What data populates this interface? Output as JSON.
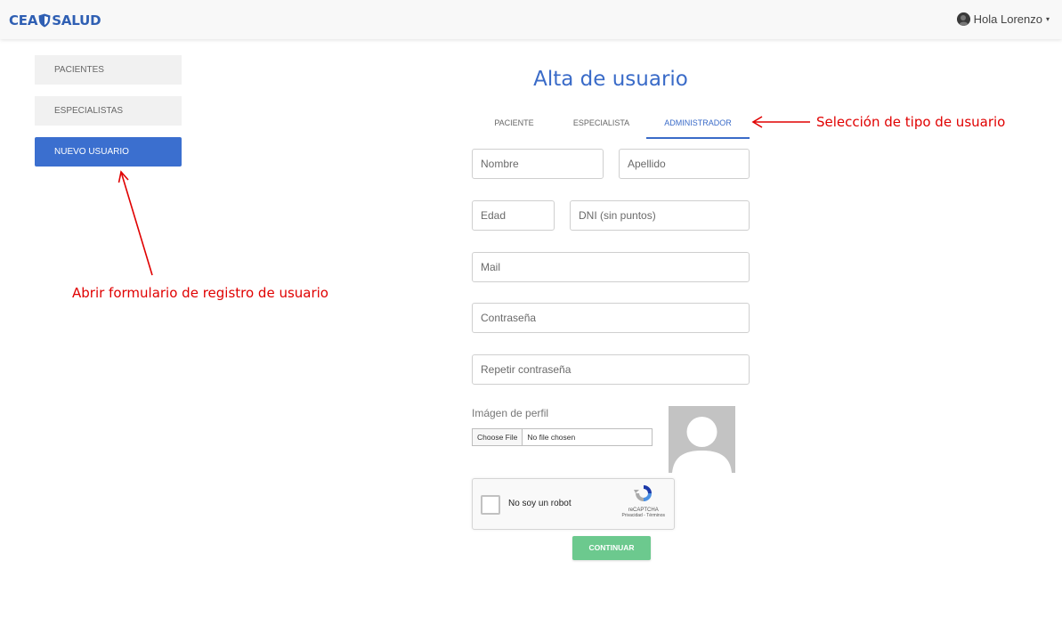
{
  "header": {
    "logo_left": "CEA",
    "logo_right": "SALUD",
    "greeting": "Hola Lorenzo",
    "caret": "▾"
  },
  "sidebar": {
    "items": [
      {
        "label": "PACIENTES",
        "active": false
      },
      {
        "label": "ESPECIALISTAS",
        "active": false
      },
      {
        "label": "NUEVO USUARIO",
        "active": true
      }
    ]
  },
  "form": {
    "title": "Alta de usuario",
    "tabs": [
      {
        "label": "PACIENTE",
        "active": false
      },
      {
        "label": "ESPECIALISTA",
        "active": false
      },
      {
        "label": "ADMINISTRADOR",
        "active": true
      }
    ],
    "fields": {
      "nombre": {
        "placeholder": "Nombre",
        "value": ""
      },
      "apellido": {
        "placeholder": "Apellido",
        "value": ""
      },
      "edad": {
        "placeholder": "Edad",
        "value": ""
      },
      "dni": {
        "placeholder": "DNI (sin puntos)",
        "value": ""
      },
      "mail": {
        "placeholder": "Mail",
        "value": ""
      },
      "password": {
        "placeholder": "Contraseña",
        "value": ""
      },
      "password_repeat": {
        "placeholder": "Repetir contraseña",
        "value": ""
      }
    },
    "profile_image": {
      "label": "Imágen de perfil",
      "button": "Choose File",
      "status": "No file chosen"
    },
    "captcha": {
      "label": "No soy un robot",
      "brand": "reCAPTCHA",
      "terms": "Privacidad - Términos"
    },
    "submit_label": "CONTINUAR"
  },
  "annotations": {
    "user_type": "Selección de tipo de usuario",
    "open_form": "Abrir formulario de registro de usuario"
  },
  "colors": {
    "brand": "#3a6bc8",
    "sidebar_active": "#3b6fcf",
    "submit": "#6cc98e",
    "annotation": "#e00000"
  }
}
